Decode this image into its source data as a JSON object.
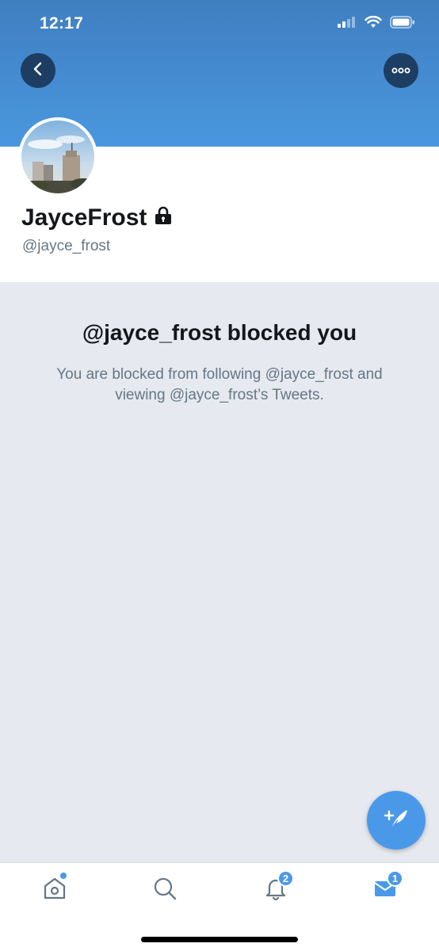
{
  "status_bar": {
    "time": "12:17"
  },
  "header": {
    "back_icon": "chevron-left-icon",
    "more_icon": "ellipsis-icon",
    "banner_color": "#4a97df"
  },
  "profile": {
    "display_name": "JayceFrost",
    "lock_icon": "lock-icon",
    "handle": "@jayce_frost"
  },
  "blocked": {
    "title": "@jayce_frost blocked you",
    "description": "You are blocked from following @jayce_frost and viewing @jayce_frost’s Tweets."
  },
  "fab": {
    "icon": "compose-tweet-icon"
  },
  "tab_bar": {
    "home": {
      "icon": "home-icon",
      "has_dot": true
    },
    "search": {
      "icon": "search-icon"
    },
    "notifications": {
      "icon": "bell-icon",
      "badge": "2"
    },
    "messages": {
      "icon": "mail-icon",
      "badge": "1"
    }
  },
  "colors": {
    "accent": "#4a99e9",
    "text_primary": "#14171a",
    "text_secondary": "#657786",
    "background": "#e6e9ef"
  }
}
